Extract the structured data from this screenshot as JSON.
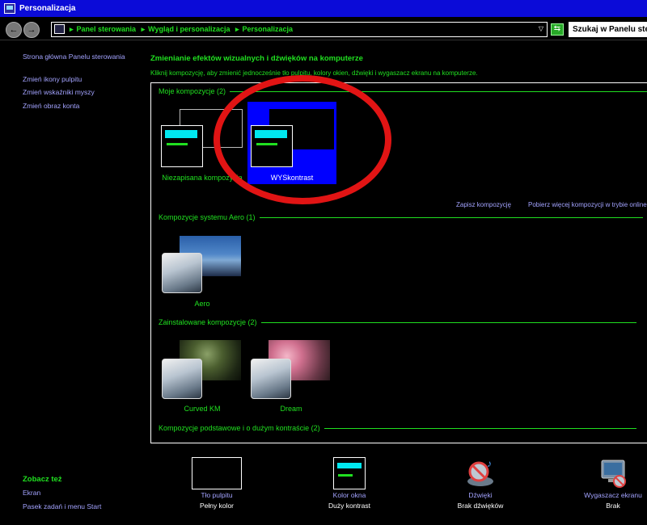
{
  "window": {
    "title": "Personalizacja"
  },
  "navbar": {
    "breadcrumbs": [
      "Panel sterowania",
      "Wygląd i personalizacja",
      "Personalizacja"
    ],
    "search_placeholder": "Szukaj w Panelu sterowania"
  },
  "sidebar": {
    "links": [
      "Strona główna Panelu sterowania",
      "Zmień ikony pulpitu",
      "Zmień wskaźniki myszy",
      "Zmień obraz konta"
    ],
    "see_also_heading": "Zobacz też",
    "see_also_links": [
      "Ekran",
      "Pasek zadań i menu Start"
    ]
  },
  "main": {
    "title": "Zmienianie efektów wizualnych i dźwięków na komputerze",
    "description": "Kliknij kompozycję, aby zmienić jednocześnie tło pulpitu, kolory okien, dźwięki i wygaszacz ekranu na komputerze.",
    "groups": [
      {
        "header": "Moje kompozycje (2)",
        "items": [
          "Niezapisana kompozycja",
          "WYSkontrast"
        ]
      },
      {
        "header": "Kompozycje systemu Aero (1)",
        "items": [
          "Aero"
        ]
      },
      {
        "header": "Zainstalowane kompozycje (2)",
        "items": [
          "Curved KM",
          "Dream"
        ]
      },
      {
        "header": "Kompozycje podstawowe i o dużym kontraście (2)",
        "items": []
      }
    ],
    "save_theme": "Zapisz kompozycję",
    "get_more_themes": "Pobierz więcej kompozycji w trybie online"
  },
  "bottom": [
    {
      "label": "Tło pulpitu",
      "value": "Pełny kolor"
    },
    {
      "label": "Kolor okna",
      "value": "Duży kontrast"
    },
    {
      "label": "Dźwięki",
      "value": "Brak dźwięków"
    },
    {
      "label": "Wygaszacz ekranu",
      "value": "Brak"
    }
  ],
  "colors": {
    "accent_green": "#20e020",
    "link_blue": "#a3a3ff",
    "selection": "#0000ff",
    "annotation_red": "#e11414"
  }
}
